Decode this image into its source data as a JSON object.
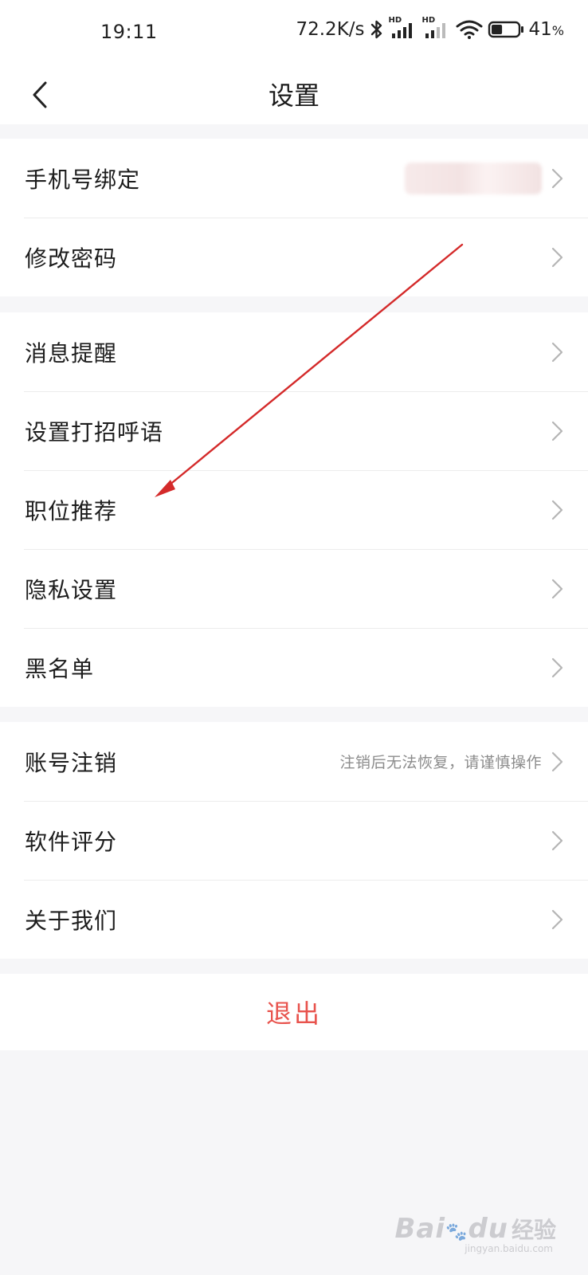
{
  "status_bar": {
    "time": "19:11",
    "net_speed": "72.2K/s",
    "sim1_tag": "HD",
    "sim2_tag": "HD",
    "battery_percent": "41",
    "battery_unit": "%",
    "battery_level": 0.41,
    "icons": [
      "bluetooth-icon",
      "signal-icon",
      "signal-icon",
      "wifi-icon",
      "battery-icon"
    ]
  },
  "nav": {
    "back_icon": "chevron-left-icon",
    "title": "设置"
  },
  "groups": [
    {
      "items": [
        {
          "label": "手机号绑定",
          "value_blurred": true
        },
        {
          "label": "修改密码"
        }
      ]
    },
    {
      "items": [
        {
          "label": "消息提醒"
        },
        {
          "label": "设置打招呼语"
        },
        {
          "label": "职位推荐"
        },
        {
          "label": "隐私设置"
        },
        {
          "label": "黑名单"
        }
      ]
    },
    {
      "items": [
        {
          "label": "账号注销",
          "value": "注销后无法恢复，请谨慎操作"
        },
        {
          "label": "软件评分"
        },
        {
          "label": "关于我们"
        }
      ]
    }
  ],
  "logout": {
    "label": "退出",
    "color": "#e8534d"
  },
  "annotation": {
    "type": "arrow",
    "color": "#d42a2a",
    "target": "职位推荐"
  },
  "watermark": {
    "brand_text": "Bai",
    "brand_tail": "du",
    "brand_cn": "经验",
    "url": "jingyan.baidu.com"
  },
  "colors": {
    "background": "#f6f6f8",
    "row_background": "#ffffff",
    "divider": "#ececec",
    "chevron": "#b5b5b5"
  }
}
